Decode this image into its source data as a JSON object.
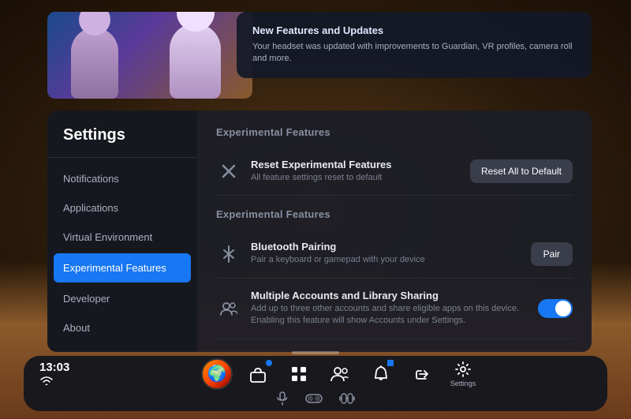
{
  "background": {
    "type": "vr-environment"
  },
  "notification": {
    "title": "New Features and Updates",
    "description": "Your headset was updated with improvements to Guardian, VR profiles, camera roll and more."
  },
  "settings": {
    "title": "Settings",
    "sidebar": {
      "items": [
        {
          "id": "notifications",
          "label": "Notifications",
          "active": false
        },
        {
          "id": "applications",
          "label": "Applications",
          "active": false
        },
        {
          "id": "virtual-environment",
          "label": "Virtual Environment",
          "active": false
        },
        {
          "id": "experimental-features",
          "label": "Experimental Features",
          "active": true
        },
        {
          "id": "developer",
          "label": "Developer",
          "active": false
        },
        {
          "id": "about",
          "label": "About",
          "active": false
        }
      ]
    },
    "content": {
      "section1_title": "Experimental Features",
      "reset_feature": {
        "name": "Reset Experimental Features",
        "description": "All feature settings reset to default",
        "button_label": "Reset All to Default"
      },
      "section2_title": "Experimental Features",
      "features": [
        {
          "id": "bluetooth",
          "name": "Bluetooth Pairing",
          "description": "Pair a keyboard or gamepad with your device",
          "control_type": "button",
          "button_label": "Pair"
        },
        {
          "id": "multi-accounts",
          "name": "Multiple Accounts and Library Sharing",
          "description": "Add up to three other accounts and share eligible apps on this device. Enabling this feature will show Accounts under Settings.",
          "control_type": "toggle",
          "toggle_on": true
        }
      ]
    }
  },
  "taskbar": {
    "time": "13:03",
    "wifi_icon": "wifi",
    "icons": [
      {
        "id": "avatar",
        "type": "avatar"
      },
      {
        "id": "store",
        "symbol": "🛍",
        "badge": true
      },
      {
        "id": "apps",
        "symbol": "⊞"
      },
      {
        "id": "people",
        "symbol": "👥"
      },
      {
        "id": "bell",
        "symbol": "🔔",
        "badge": true
      },
      {
        "id": "share",
        "symbol": "↪"
      },
      {
        "id": "settings",
        "symbol": "⚙",
        "label": "Settings"
      }
    ],
    "bottom_icons": [
      {
        "id": "mic",
        "symbol": "🎤"
      },
      {
        "id": "vr",
        "symbol": "👓"
      },
      {
        "id": "headset",
        "symbol": "🎧"
      }
    ]
  }
}
